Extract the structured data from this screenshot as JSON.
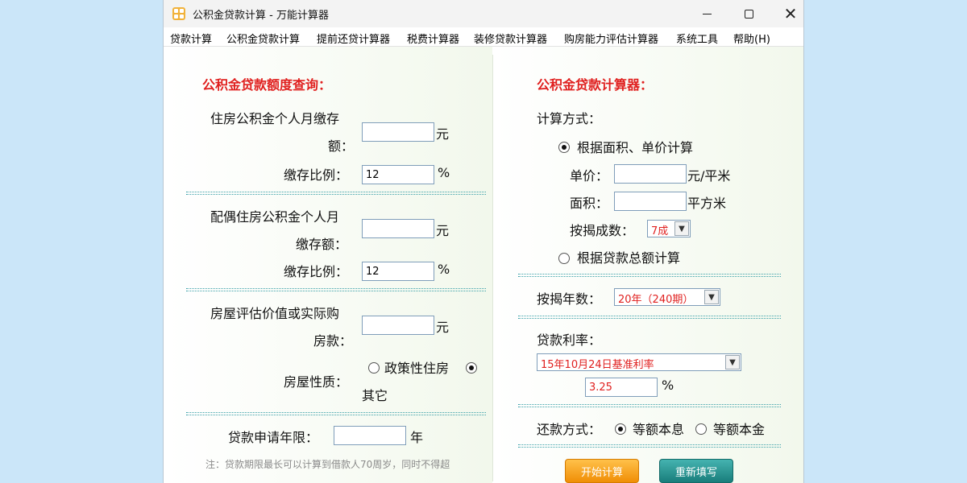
{
  "window": {
    "title": "公积金贷款计算 - 万能计算器"
  },
  "menu": [
    "贷款计算",
    "公积金贷款计算",
    "提前还贷计算器",
    "税费计算器",
    "装修贷款计算器",
    "购房能力评估计算器",
    "系统工具",
    "帮助(H)"
  ],
  "left": {
    "title": "公积金贷款额度查询：",
    "monthly_label_1": "住房公积金个人月缴存",
    "monthly_label_2": "额：",
    "monthly_value": "",
    "monthly_unit": "元",
    "ratio_label": "缴存比例：",
    "ratio_value": "12",
    "ratio_unit": "%",
    "spouse_label_1": "配偶住房公积金个人月",
    "spouse_label_2": "缴存额：",
    "spouse_value": "",
    "spouse_unit": "元",
    "spouse_ratio_label": "缴存比例：",
    "spouse_ratio_value": "12",
    "spouse_ratio_unit": "%",
    "price_label_1": "房屋评估价值或实际购",
    "price_label_2": "房款：",
    "price_value": "",
    "price_unit": "元",
    "nature_label": "房屋性质：",
    "nature_option_1": "政策性住房",
    "nature_option_2": "其它",
    "nature_selected": "其它",
    "years_label": "贷款申请年限：",
    "years_value": "",
    "years_unit": "年",
    "note": "注：贷款期限最长可以计算到借款人70周岁，同时不得超"
  },
  "right": {
    "title": "公积金贷款计算器：",
    "method_label": "计算方式：",
    "method_option_1": "根据面积、单价计算",
    "method_option_2": "根据贷款总额计算",
    "method_selected": "根据面积、单价计算",
    "unit_price_label": "单价：",
    "unit_price_value": "",
    "unit_price_unit": "元/平米",
    "area_label": "面积：",
    "area_value": "",
    "area_unit": "平方米",
    "ratio_label": "按揭成数：",
    "ratio_selected": "7成",
    "years_label": "按揭年数：",
    "years_selected": "20年（240期）",
    "rate_label": "贷款利率：",
    "rate_selected": "15年10月24日基准利率",
    "rate_value": "3.25",
    "rate_unit": "%",
    "repay_label": "还款方式：",
    "repay_option_1": "等额本息",
    "repay_option_2": "等额本金",
    "repay_selected": "等额本息",
    "calc_button": "开始计算",
    "reset_button": "重新填写"
  },
  "colors": {
    "accent_red": "#e0201f",
    "background": "#cbe6f9",
    "calc_button": "#f39c12",
    "reset_button": "#1e8683"
  }
}
